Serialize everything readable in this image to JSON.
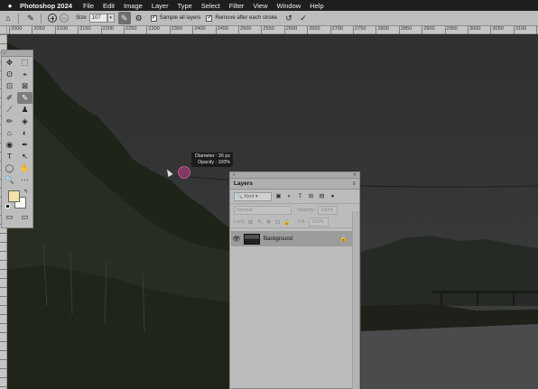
{
  "menubar": {
    "apple": "",
    "app_name": "Photoshop 2024",
    "items": [
      "File",
      "Edit",
      "Image",
      "Layer",
      "Type",
      "Select",
      "Filter",
      "View",
      "Window",
      "Help"
    ]
  },
  "options_bar": {
    "home_icon": "⌂",
    "tool_icon": "✎",
    "size_label": "Size",
    "size_value": "107",
    "sample_all_layers_label": "Sample all layers",
    "sample_all_layers_checked": true,
    "remove_after_stroke_label": "Remove after each stroke",
    "remove_after_stroke_checked": true,
    "undo_icon": "↺",
    "commit_icon": "✓"
  },
  "ruler": {
    "labels": [
      "2000",
      "2050",
      "2100",
      "2150",
      "2200",
      "2250",
      "2300",
      "2350",
      "2400",
      "2450",
      "2500",
      "2550",
      "2600",
      "2650",
      "2700",
      "2750",
      "2800",
      "2850",
      "2900",
      "2950",
      "3000",
      "3050",
      "3100",
      "3150"
    ]
  },
  "tooltip": {
    "diameter": "Diameter : 26 px",
    "opacity": "Opacity : 100%"
  },
  "toolbar": {
    "rows": [
      [
        "✥",
        "⬚"
      ],
      [
        "ʘ",
        "⌖"
      ],
      [
        "⊡",
        "⊠"
      ],
      [
        "✐",
        "✎"
      ],
      [
        "⟋",
        "♟"
      ],
      [
        "✏",
        "◈"
      ],
      [
        "⌂",
        "◐"
      ],
      [
        "◉",
        "✒"
      ],
      [
        "T",
        "↖"
      ],
      [
        "◯",
        "✋"
      ],
      [
        "🔍",
        "⋯"
      ]
    ],
    "colors": {
      "foreground": "#f3e2a5",
      "background": "#ffffff"
    },
    "bottom": [
      "▭",
      "▭"
    ]
  },
  "layers_panel": {
    "tab_label": "Layers",
    "filter_kind": "Kind",
    "blend_mode": "Normal",
    "opacity_label": "Opacity:",
    "opacity_value": "100%",
    "lock_label": "Lock:",
    "fill_label": "Fill:",
    "fill_value": "100%",
    "layers": [
      {
        "name": "Background",
        "visible": true,
        "locked": true
      }
    ]
  }
}
